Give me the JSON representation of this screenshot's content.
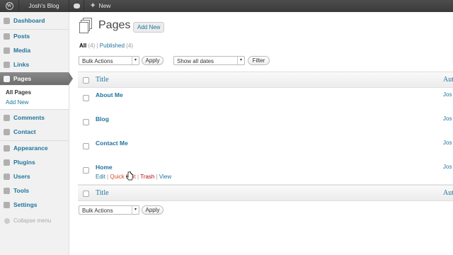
{
  "adminbar": {
    "site_name": "Josh's Blog",
    "new_label": "New"
  },
  "sidebar": {
    "items": [
      {
        "label": "Dashboard"
      },
      {
        "label": "Posts"
      },
      {
        "label": "Media"
      },
      {
        "label": "Links"
      },
      {
        "label": "Pages"
      },
      {
        "label": "Comments"
      },
      {
        "label": "Contact"
      },
      {
        "label": "Appearance"
      },
      {
        "label": "Plugins"
      },
      {
        "label": "Users"
      },
      {
        "label": "Tools"
      },
      {
        "label": "Settings"
      }
    ],
    "submenu": {
      "all_pages": "All Pages",
      "add_new": "Add New"
    },
    "collapse": "Collapse menu"
  },
  "header": {
    "title": "Pages",
    "add_new": "Add New"
  },
  "filters": {
    "all_label": "All",
    "all_count": "(4)",
    "sep": "|",
    "published_label": "Published",
    "published_count": "(4)"
  },
  "toolbar": {
    "bulk_actions": "Bulk Actions",
    "apply": "Apply",
    "dates": "Show all dates",
    "filter": "Filter"
  },
  "table": {
    "col_title": "Title",
    "col_author": "Aut",
    "rows": [
      {
        "title": "About Me",
        "author": "Jos"
      },
      {
        "title": "Blog",
        "author": "Jos"
      },
      {
        "title": "Contact Me",
        "author": "Jos"
      },
      {
        "title": "Home",
        "author": "Jos"
      }
    ],
    "row_actions": {
      "edit": "Edit",
      "quick_edit": "Quick Edit",
      "trash": "Trash",
      "view": "View",
      "sep": "|"
    }
  },
  "bottom_toolbar": {
    "bulk_actions": "Bulk Actions",
    "apply": "Apply"
  },
  "colors": {
    "link": "#21759b",
    "active_menu": "#777777",
    "trash": "#bc0b0b",
    "quick_edit": "#d54e21"
  }
}
